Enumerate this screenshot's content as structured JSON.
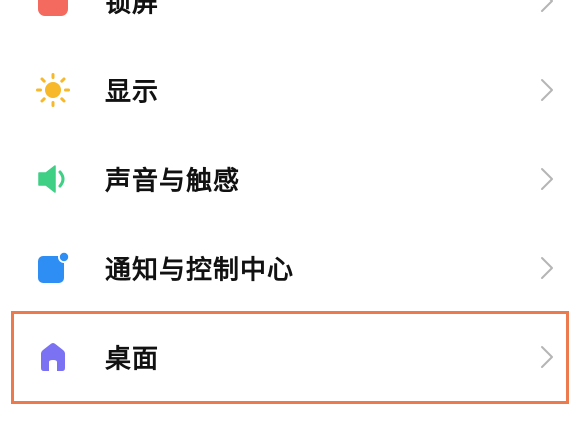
{
  "settings": {
    "items": [
      {
        "label": "锁屏",
        "icon": "lock-screen-icon",
        "color": "#f46a5e"
      },
      {
        "label": "显示",
        "icon": "sun-icon",
        "color": "#f7b82a"
      },
      {
        "label": "声音与触感",
        "icon": "speaker-icon",
        "color": "#3fcf85"
      },
      {
        "label": "通知与控制中心",
        "icon": "notification-icon",
        "color": "#2f8ef4"
      },
      {
        "label": "桌面",
        "icon": "home-icon",
        "color": "#7a72f2"
      }
    ]
  },
  "colors": {
    "highlight": "#ed7a4d",
    "chevron": "#b5b5b5",
    "text": "#111111"
  }
}
